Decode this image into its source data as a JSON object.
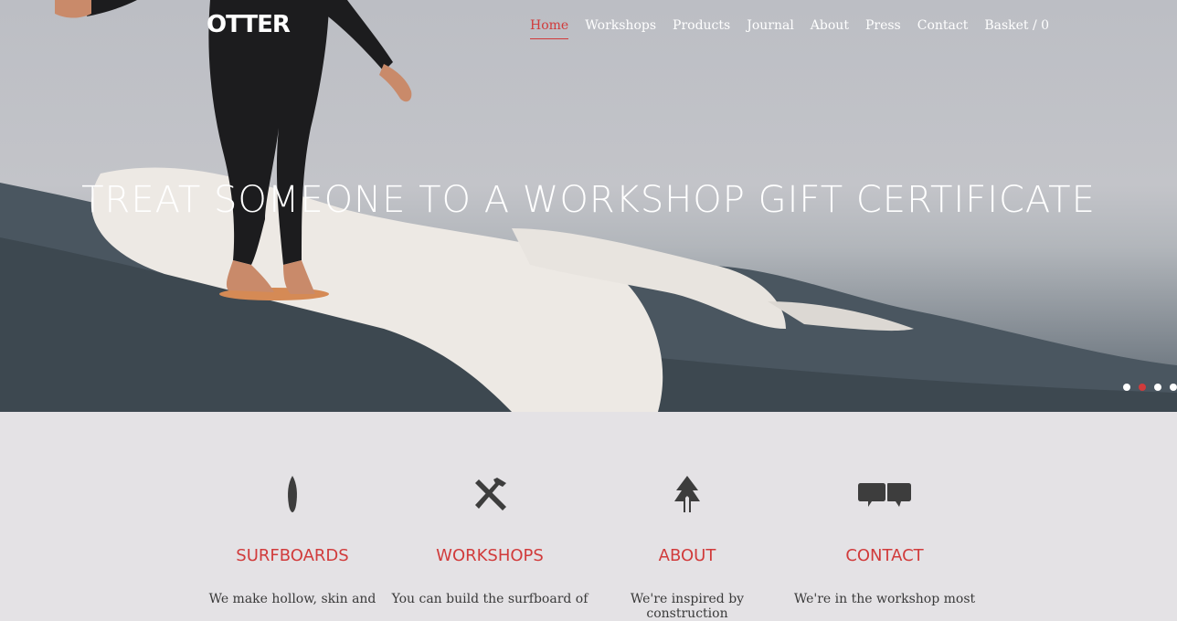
{
  "brand": {
    "logo": "OTTER"
  },
  "nav": {
    "items": [
      "Home",
      "Workshops",
      "Products",
      "Journal",
      "About",
      "Press",
      "Contact",
      "Basket / 0"
    ],
    "active": "Home"
  },
  "hero": {
    "headline": "TREAT SOMEONE TO A WORKSHOP GIFT CERTIFICATE",
    "slides_total": 4,
    "active_slide": 2
  },
  "features": [
    {
      "icon": "surfboard-icon",
      "title": "SURFBOARDS",
      "text": "We make hollow, skin and"
    },
    {
      "icon": "tools-icon",
      "title": "WORKSHOPS",
      "text": "You can build the surfboard of"
    },
    {
      "icon": "tree-icon",
      "title": "ABOUT",
      "text": "We're inspired by construction"
    },
    {
      "icon": "speech-bubbles-icon",
      "title": "CONTACT",
      "text": "We're in the workshop most"
    }
  ],
  "colors": {
    "accent": "#d13b3b",
    "background": "#e4e2e5",
    "icon": "#3d3d3d"
  }
}
